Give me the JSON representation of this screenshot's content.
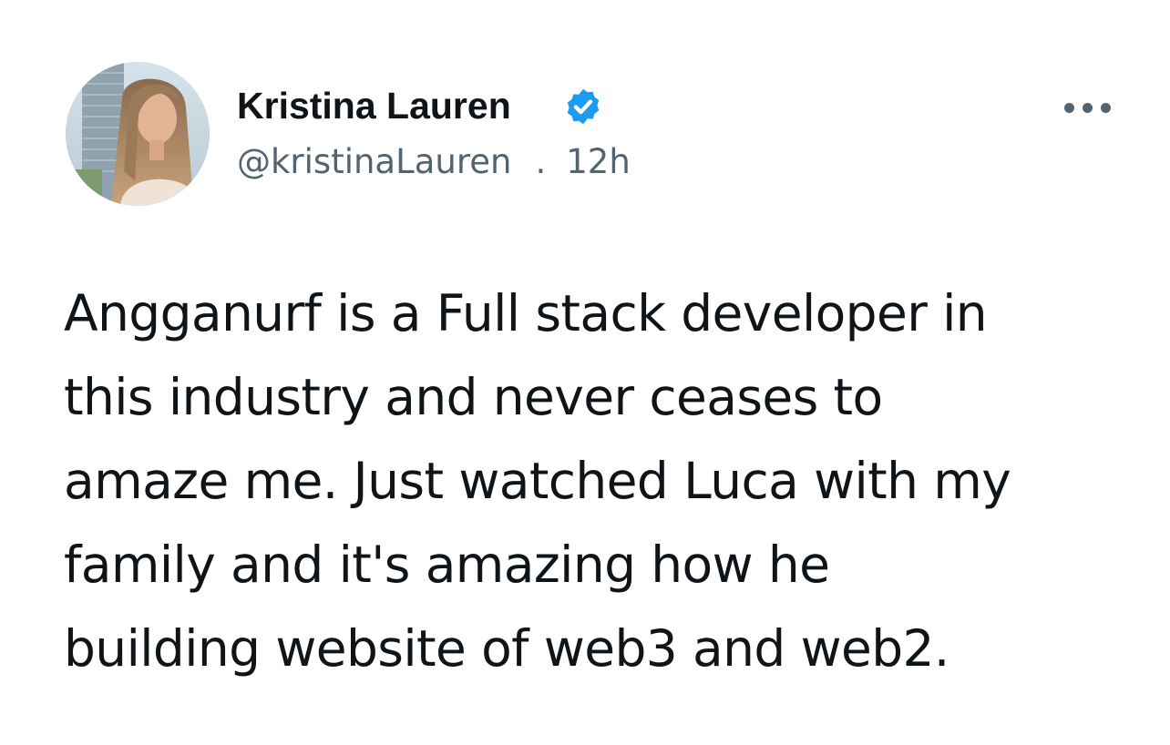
{
  "author": {
    "display_name": "Kristina Lauren",
    "handle": "@kristinaLauren",
    "separator": ".",
    "timestamp": "12h",
    "verified": true,
    "verified_icon": "verified-badge-icon",
    "avatar_icon": "avatar-photo"
  },
  "actions": {
    "more_icon": "more-horizontal-icon"
  },
  "tweet": {
    "text_lines": [
      "Angganurf is a Full stack developer in",
      "this industry and never ceases to",
      "amaze me. Just watched Luca with my",
      "family and it's amazing how he",
      "building website of web3 and web2."
    ]
  },
  "colors": {
    "text_primary": "#0f1419",
    "text_secondary": "#536471",
    "verified_blue": "#1d9bf0",
    "background": "#ffffff"
  }
}
